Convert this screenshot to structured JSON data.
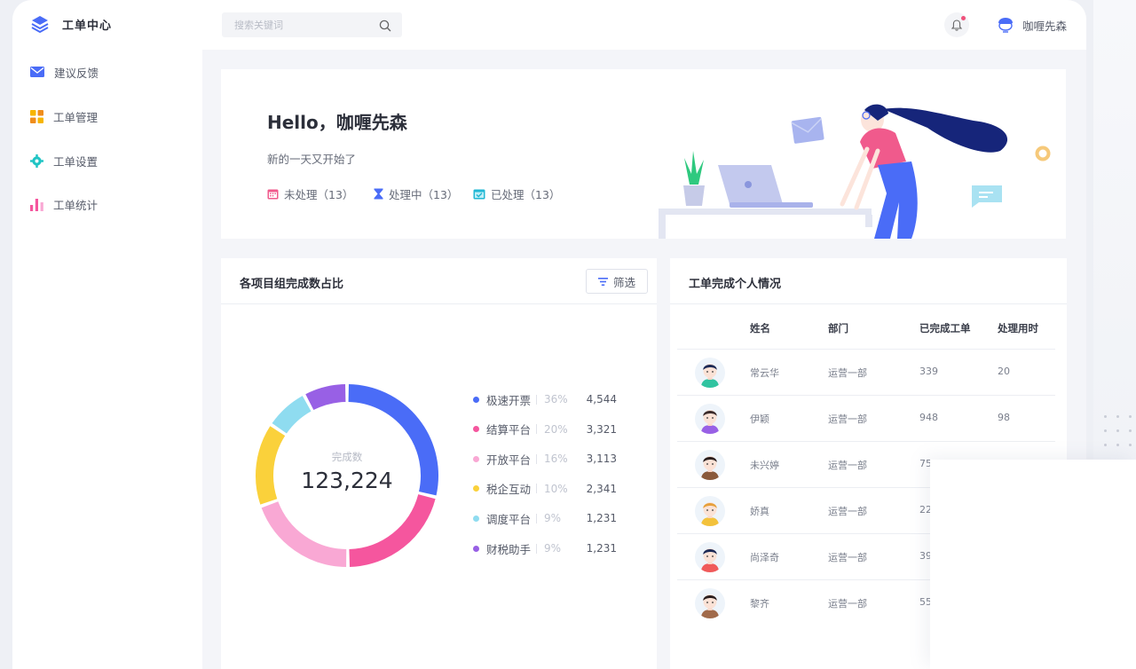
{
  "app": {
    "title": "工单中心"
  },
  "sidebar": {
    "items": [
      {
        "label": "建议反馈",
        "icon": "mail-icon"
      },
      {
        "label": "工单管理",
        "icon": "grid-icon"
      },
      {
        "label": "工单设置",
        "icon": "gear-icon"
      },
      {
        "label": "工单统计",
        "icon": "bar-chart-icon"
      }
    ]
  },
  "header": {
    "search_placeholder": "搜索关键词",
    "user_name": "咖喱先森"
  },
  "hero": {
    "greeting": "Hello，咖喱先森",
    "subtitle": "新的一天又开始了",
    "stats": [
      {
        "label": "未处理（13）",
        "color": "#f05a8c"
      },
      {
        "label": "处理中（13）",
        "color": "#4a6cf7"
      },
      {
        "label": "已处理（13）",
        "color": "#22b8d4"
      }
    ]
  },
  "project_card": {
    "title": "各项目组完成数占比",
    "filter_label": "筛选",
    "center_label": "完成数",
    "center_value": "123,224"
  },
  "chart_data": {
    "type": "pie",
    "categories": [
      "极速开票",
      "结算平台",
      "开放平台",
      "税企互动",
      "调度平台",
      "财税助手"
    ],
    "percents": [
      "36%",
      "20%",
      "16%",
      "10%",
      "9%",
      "9%"
    ],
    "values_display": [
      "4,544",
      "3,321",
      "3,113",
      "2,341",
      "1,231",
      "1,231"
    ],
    "values": [
      4544,
      3321,
      3113,
      2341,
      1231,
      1231
    ],
    "colors": [
      "#4a6cf7",
      "#f5569e",
      "#f9a8d4",
      "#fad13b",
      "#8fdcf0",
      "#9860e5"
    ]
  },
  "person_card": {
    "title": "工单完成个人情况",
    "columns": [
      "姓名",
      "部门",
      "已完成工单",
      "处理用时"
    ],
    "rows": [
      {
        "name": "常云华",
        "dept": "运营一部",
        "done": "339",
        "time": "20"
      },
      {
        "name": "伊颖",
        "dept": "运营一部",
        "done": "948",
        "time": "98"
      },
      {
        "name": "未兴婷",
        "dept": "运营一部",
        "done": "75",
        "time": ""
      },
      {
        "name": "娇真",
        "dept": "运营一部",
        "done": "22",
        "time": ""
      },
      {
        "name": "尚泽奇",
        "dept": "运营一部",
        "done": "39",
        "time": ""
      },
      {
        "name": "黎齐",
        "dept": "运营一部",
        "done": "55",
        "time": ""
      }
    ]
  }
}
